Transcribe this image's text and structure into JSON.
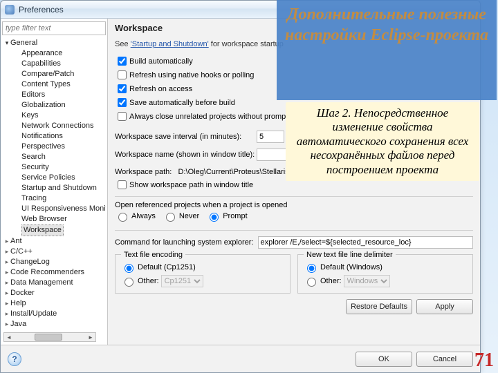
{
  "window": {
    "title": "Preferences"
  },
  "sidebar": {
    "filter_placeholder": "type filter text",
    "items": [
      {
        "label": "General",
        "expanded": true,
        "children": [
          {
            "label": "Appearance"
          },
          {
            "label": "Capabilities"
          },
          {
            "label": "Compare/Patch"
          },
          {
            "label": "Content Types"
          },
          {
            "label": "Editors"
          },
          {
            "label": "Globalization"
          },
          {
            "label": "Keys"
          },
          {
            "label": "Network Connections"
          },
          {
            "label": "Notifications"
          },
          {
            "label": "Perspectives"
          },
          {
            "label": "Search"
          },
          {
            "label": "Security"
          },
          {
            "label": "Service Policies"
          },
          {
            "label": "Startup and Shutdown"
          },
          {
            "label": "Tracing"
          },
          {
            "label": "UI Responsiveness Monitoring"
          },
          {
            "label": "Web Browser"
          },
          {
            "label": "Workspace",
            "selected": true
          }
        ]
      },
      {
        "label": "Ant"
      },
      {
        "label": "C/C++"
      },
      {
        "label": "ChangeLog"
      },
      {
        "label": "Code Recommenders"
      },
      {
        "label": "Data Management"
      },
      {
        "label": "Docker"
      },
      {
        "label": "Help"
      },
      {
        "label": "Install/Update"
      },
      {
        "label": "Java"
      }
    ]
  },
  "page": {
    "heading": "Workspace",
    "see_prefix": "See ",
    "see_link": "'Startup and Shutdown'",
    "see_suffix": " for workspace startup",
    "checks": [
      {
        "label": "Build automatically",
        "checked": true
      },
      {
        "label": "Refresh using native hooks or polling",
        "checked": false
      },
      {
        "label": "Refresh on access",
        "checked": true
      },
      {
        "label": "Save automatically before build",
        "checked": true
      },
      {
        "label": "Always close unrelated projects without prompt",
        "checked": false
      }
    ],
    "save_interval_label": "Workspace save interval (in minutes):",
    "save_interval_value": "5",
    "workspace_name_label": "Workspace name (shown in window title):",
    "workspace_name_value": "",
    "workspace_path_label": "Workspace path:",
    "workspace_path_value": "D:\\Oleg\\Current\\Proteus\\Stellaris",
    "show_path_label": "Show workspace path in window title",
    "open_ref_label": "Open referenced projects when a project is opened",
    "open_ref_options": [
      "Always",
      "Never",
      "Prompt"
    ],
    "open_ref_value": "Prompt",
    "command_label": "Command for launching system explorer:",
    "command_value": "explorer /E,/select=${selected_resource_loc}",
    "encoding": {
      "title": "Text file encoding",
      "default_label": "Default (Cp1251)",
      "other_label": "Other:",
      "other_value": "Cp1251",
      "value": "default"
    },
    "delimiter": {
      "title": "New text file line delimiter",
      "default_label": "Default (Windows)",
      "other_label": "Other:",
      "other_value": "Windows",
      "value": "default"
    },
    "buttons": {
      "restore": "Restore Defaults",
      "apply": "Apply",
      "ok": "OK",
      "cancel": "Cancel"
    }
  },
  "overlay": {
    "title": "Дополнительные полезные настройки Eclipse-проекта",
    "step": "Шаг 2. Непосредственное изменение свойства автоматического сохранения всех несохранённых файлов перед построением проекта",
    "slide": "71"
  }
}
